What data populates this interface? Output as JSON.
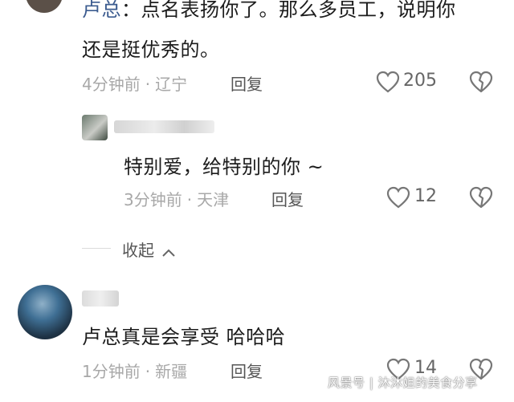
{
  "comment1": {
    "user_prefix": "卢总",
    "text_line1_rest": "：点名表扬你了。那么多员工，说明你",
    "text_line2": "还是挺优秀的。",
    "time": "4分钟前",
    "location": "辽宁",
    "reply_label": "回复",
    "likes": "205",
    "like_icon": "heart-outline-icon",
    "dislike_icon": "broken-heart-icon"
  },
  "reply1": {
    "text": "特别爱，给特别的你 ~",
    "time": "3分钟前",
    "location": "天津",
    "reply_label": "回复",
    "likes": "12"
  },
  "collapse": {
    "label": "收起"
  },
  "comment2": {
    "text": "卢总真是会享受 哈哈哈",
    "time": "1分钟前",
    "location": "新疆",
    "reply_label": "回复",
    "likes": "14"
  },
  "watermark": "风景号 | 沐沐姐的美食分享"
}
